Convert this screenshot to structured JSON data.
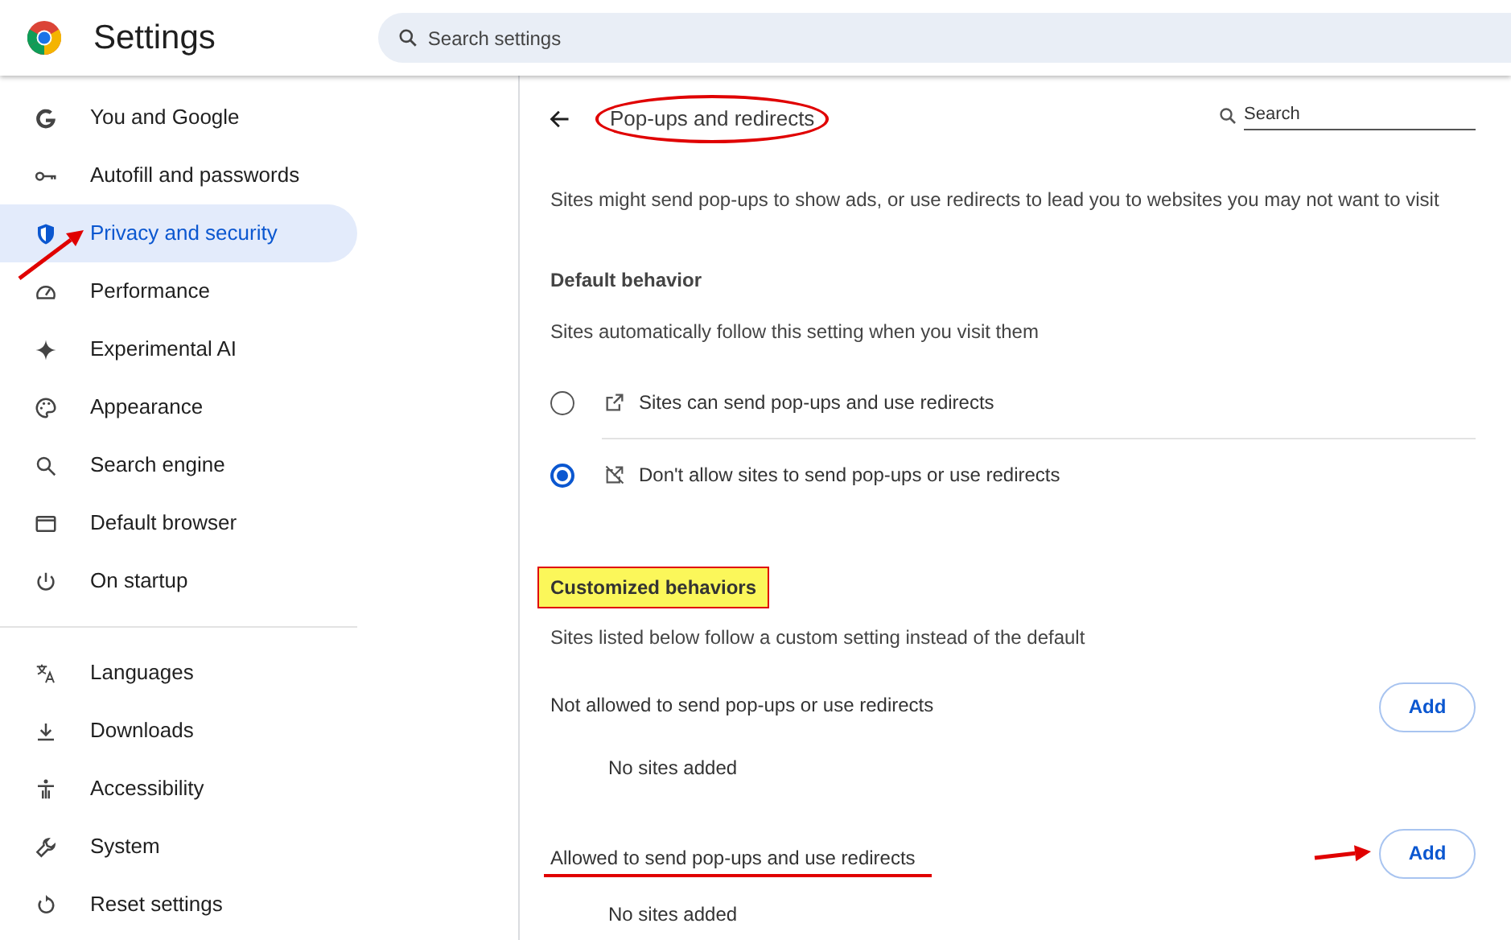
{
  "header": {
    "title": "Settings",
    "search": {
      "placeholder": "Search settings"
    }
  },
  "sidebar": {
    "groups": [
      [
        {
          "label": "You and Google",
          "selected": false,
          "arrow": false
        },
        {
          "label": "Autofill and passwords",
          "selected": false,
          "arrow": false
        },
        {
          "label": "Privacy and security",
          "selected": true,
          "arrow": true
        },
        {
          "label": "Performance",
          "selected": false,
          "arrow": false
        },
        {
          "label": "Experimental AI",
          "selected": false,
          "arrow": false
        },
        {
          "label": "Appearance",
          "selected": false,
          "arrow": false
        },
        {
          "label": "Search engine",
          "selected": false,
          "arrow": false
        },
        {
          "label": "Default browser",
          "selected": false,
          "arrow": false
        },
        {
          "label": "On startup",
          "selected": false,
          "arrow": false
        }
      ],
      [
        {
          "label": "Languages",
          "selected": false,
          "arrow": false
        },
        {
          "label": "Downloads",
          "selected": false,
          "arrow": false
        },
        {
          "label": "Accessibility",
          "selected": false,
          "arrow": false
        },
        {
          "label": "System",
          "selected": false,
          "arrow": false
        },
        {
          "label": "Reset settings",
          "selected": false,
          "arrow": false
        }
      ]
    ]
  },
  "page": {
    "title": "Pop-ups and redirects",
    "title_circled": true,
    "search": {
      "placeholder": "Search"
    },
    "description": "Sites might send pop-ups to show ads, or use redirects to lead you to websites you may not want to visit",
    "default_behavior": {
      "heading": "Default behavior",
      "subtitle": "Sites automatically follow this setting when you visit them",
      "options": [
        {
          "label": "Sites can send pop-ups and use redirects",
          "selected": false
        },
        {
          "label": "Don't allow sites to send pop-ups or use redirects",
          "selected": true
        }
      ]
    },
    "customized": {
      "heading": "Customized behaviors",
      "heading_highlighted": true,
      "subtitle": "Sites listed below follow a custom setting instead of the default",
      "lists": [
        {
          "label": "Not allowed to send pop-ups or use redirects",
          "underlined": false,
          "button": "Add",
          "button_arrow": false,
          "empty": "No sites added"
        },
        {
          "label": "Allowed to send pop-ups and use redirects",
          "underlined": true,
          "button": "Add",
          "button_arrow": true,
          "empty": "No sites added"
        }
      ]
    }
  }
}
